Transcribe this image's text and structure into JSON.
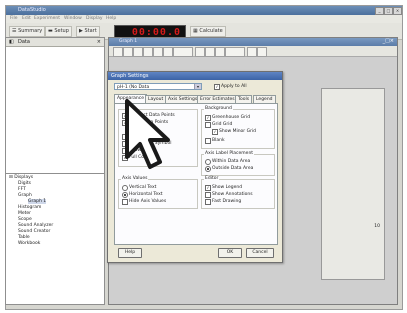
{
  "app": {
    "title": "DataStudio",
    "menus": [
      "File",
      "Edit",
      "Experiment",
      "Window",
      "Display",
      "Help"
    ]
  },
  "toolbar": {
    "summary_label": "Summary",
    "setup_label": "Setup",
    "start_label": "Start",
    "timer_value": "00:00.0",
    "calculator_label": "Calculate"
  },
  "data_panel": {
    "header": "Data"
  },
  "tree": {
    "root": "Displays",
    "items": [
      "Digits",
      "FFT",
      "Graph",
      "Graph 1",
      "Histogram",
      "Meter",
      "Scope",
      "Sound Analyzer",
      "Sound Creator",
      "Table",
      "Workbook"
    ]
  },
  "graph_window": {
    "title": "Graph 1",
    "axis_tick": "10"
  },
  "dialog": {
    "title": "Graph Settings",
    "combo_value": "pH-1 (No Data",
    "apply_all_label": "Apply to All",
    "tabs": [
      "Appearance",
      "Layout",
      "Axis Settings",
      "Error Estimates",
      "Tools",
      "Legend"
    ],
    "left_options": [
      "Connect Data Points",
      "Show Data Points",
      "Bold",
      "Show Points",
      "Show Most Symbol",
      "Show Lines",
      "Full Colors"
    ],
    "background": {
      "title": "Background",
      "options": [
        "Greenhouse Grid",
        "Grid Grid",
        "Show Minor Grid",
        "Blank"
      ]
    },
    "axis_label": {
      "title": "Axis Label Placement",
      "options": [
        "Within Data Area",
        "Outside Data Area"
      ]
    },
    "axis_values": {
      "title": "Axis Values",
      "options": [
        "Vertical Text",
        "Horizontal Text",
        "Hide Axis Values"
      ]
    },
    "editor": {
      "title": "Editor",
      "options": [
        "Show Legend",
        "Show Annotations",
        "Fast Drawing"
      ]
    },
    "help_label": "Help",
    "ok_label": "OK",
    "cancel_label": "Cancel"
  },
  "colors": {
    "timer_digits": "#d41a1a",
    "title_bar": "#4b6f9c"
  }
}
